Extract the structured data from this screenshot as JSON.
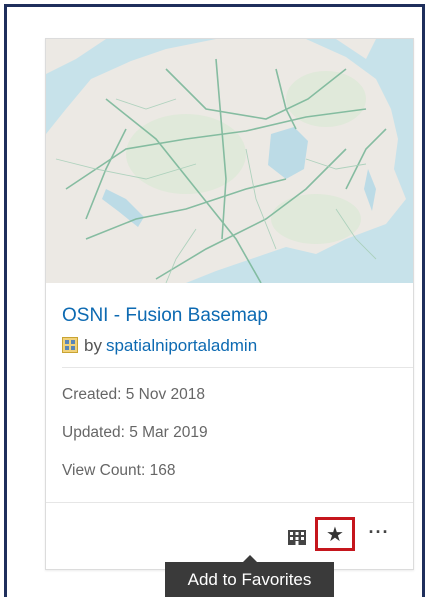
{
  "card": {
    "title": "OSNI - Fusion Basemap",
    "owner_prefix": "by",
    "owner": "spatialniportaladmin",
    "type_icon": "map-service-icon",
    "created": "Created: 5 Nov 2018",
    "updated": "Updated: 5 Mar 2019",
    "view_count": "View Count: 168"
  },
  "actions": {
    "details_icon": "building-grid-icon",
    "favorite_icon": "star-icon",
    "favorite_glyph": "★",
    "more_icon": "ellipsis-icon",
    "more_glyph": "···"
  },
  "tooltip": {
    "text": "Add to Favorites"
  },
  "colors": {
    "link": "#0d6ab2",
    "frame": "#1f2f5c",
    "highlight": "#c5161d",
    "tooltip_bg": "#3a3a3a"
  }
}
